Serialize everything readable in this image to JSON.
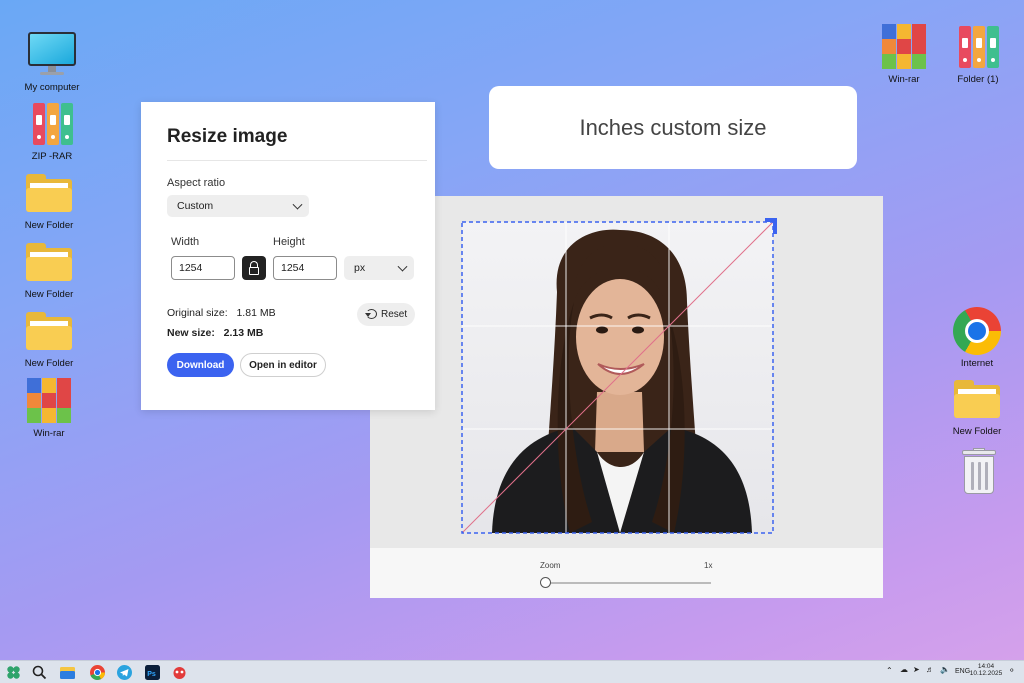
{
  "desktop": {
    "left_icons": [
      {
        "label": "My computer",
        "icon": "computer-icon"
      },
      {
        "label": "ZIP -RAR",
        "icon": "binders-icon"
      },
      {
        "label": "New Folder",
        "icon": "folder-icon"
      },
      {
        "label": "New Folder",
        "icon": "folder-icon"
      },
      {
        "label": "New Folder",
        "icon": "folder-icon"
      },
      {
        "label": "Win-rar",
        "icon": "winrar-icon"
      }
    ],
    "right_icons": [
      {
        "label": "Win-rar",
        "icon": "winrar-icon"
      },
      {
        "label": "Folder (1)",
        "icon": "binders-icon"
      },
      {
        "label": "Internet",
        "icon": "chrome-icon"
      },
      {
        "label": "New Folder",
        "icon": "folder-icon"
      },
      {
        "label": "",
        "icon": "trash-icon"
      }
    ]
  },
  "resize_panel": {
    "title": "Resize image",
    "aspect_ratio_label": "Aspect ratio",
    "aspect_ratio_value": "Custom",
    "width_label": "Width",
    "width_value": "1254",
    "height_label": "Height",
    "height_value": "1254",
    "unit_value": "px",
    "original_size_label": "Original size:",
    "original_size_value": "1.81 MB",
    "new_size_label": "New size:",
    "new_size_value": "2.13 MB",
    "reset_label": "Reset",
    "download_label": "Download",
    "open_editor_label": "Open in editor",
    "accent_color": "#3b63f0"
  },
  "heading_card": {
    "text": "Inches custom size"
  },
  "editor": {
    "zoom_label": "Zoom",
    "zoom_value": "1x",
    "zoom_level": 0,
    "crop_color": "#3b63f0"
  },
  "taskbar": {
    "apps": [
      "start-icon",
      "search-icon",
      "file-explorer-icon",
      "chrome-icon",
      "telegram-icon",
      "photoshop-icon",
      "app-icon"
    ],
    "language": "ENG",
    "time": "14:04",
    "date": "10.12.2025"
  }
}
